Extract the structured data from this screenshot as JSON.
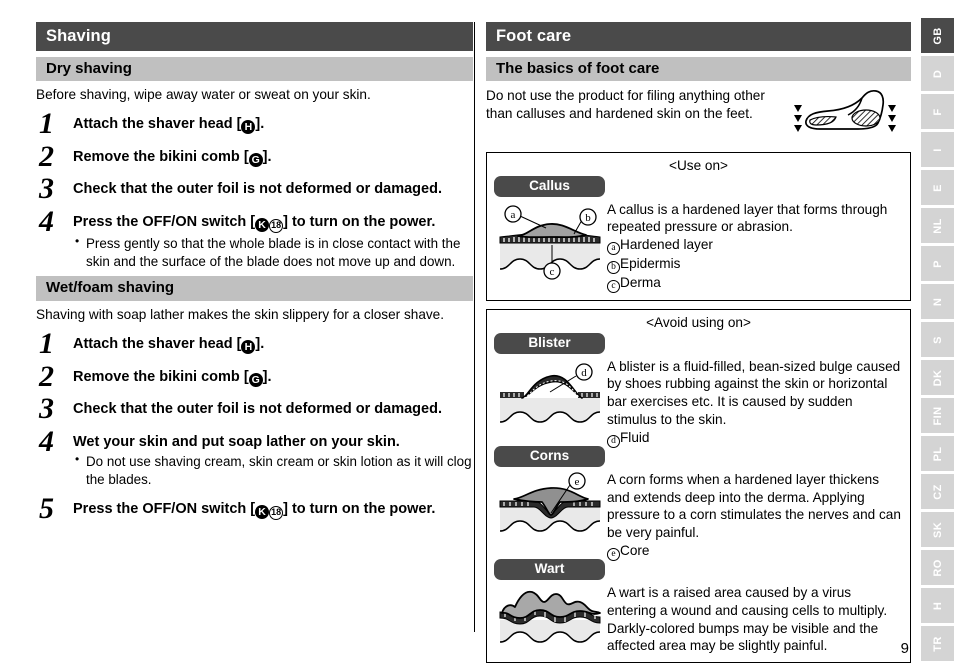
{
  "page_number": "9",
  "left_column": {
    "section_title": "Shaving",
    "subsections": [
      {
        "title": "Dry shaving",
        "intro": "Before shaving, wipe away water or sweat on your skin.",
        "steps": [
          {
            "num": "1",
            "text_before": "Attach the shaver head [",
            "ref": "H",
            "ref_type": "filled",
            "text_after": "].",
            "bullets": []
          },
          {
            "num": "2",
            "text_before": "Remove the bikini comb [",
            "ref": "G",
            "ref_type": "filled",
            "text_after": "].",
            "bullets": []
          },
          {
            "num": "3",
            "text_before": "Check that the outer foil is not deformed or damaged.",
            "ref": "",
            "ref_type": "none",
            "text_after": "",
            "bullets": []
          },
          {
            "num": "4",
            "text_before": "Press the OFF/ON switch [",
            "ref": "K",
            "ref_type": "filled",
            "ref2": "18",
            "ref2_type": "open",
            "text_after": "] to turn on the power.",
            "bullets": [
              "Press gently so that the whole blade is in close contact with the skin and the surface of the blade does not move up and down."
            ]
          }
        ]
      },
      {
        "title": "Wet/foam shaving",
        "intro": "Shaving with soap lather makes the skin slippery for a closer shave.",
        "steps": [
          {
            "num": "1",
            "text_before": "Attach the shaver head [",
            "ref": "H",
            "ref_type": "filled",
            "text_after": "].",
            "bullets": []
          },
          {
            "num": "2",
            "text_before": "Remove the bikini comb [",
            "ref": "G",
            "ref_type": "filled",
            "text_after": "].",
            "bullets": []
          },
          {
            "num": "3",
            "text_before": "Check that the outer foil is not deformed or damaged.",
            "ref": "",
            "ref_type": "none",
            "text_after": "",
            "bullets": []
          },
          {
            "num": "4",
            "text_before": "Wet your skin and put soap lather on your skin.",
            "ref": "",
            "ref_type": "none",
            "text_after": "",
            "bullets": [
              "Do not use shaving cream, skin cream or skin lotion as it will clog the blades."
            ]
          },
          {
            "num": "5",
            "text_before": "Press the OFF/ON switch [",
            "ref": "K",
            "ref_type": "filled",
            "ref2": "18",
            "ref2_type": "open",
            "text_after": "] to turn on the power.",
            "bullets": []
          }
        ]
      }
    ]
  },
  "right_column": {
    "section_title": "Foot care",
    "sub_title": "The basics of foot care",
    "basics_text": "Do not use the product for filing anything other than calluses and hardened skin on the feet.",
    "foot_figure_name": "foot-side-profile-with-callus-areas",
    "panels": [
      {
        "caption": "<Use on>",
        "conditions": [
          {
            "badge": "Callus",
            "description": "A callus is a hardened layer that forms through repeated pressure or abrasion.",
            "legend": [
              {
                "letter": "a",
                "label": "Hardened layer"
              },
              {
                "letter": "b",
                "label": "Epidermis"
              },
              {
                "letter": "c",
                "label": "Derma"
              }
            ],
            "figure_labels": [
              "a",
              "b",
              "c"
            ],
            "figure_name": "callus-skin-cross-section"
          }
        ]
      },
      {
        "caption": "<Avoid using on>",
        "conditions": [
          {
            "badge": "Blister",
            "description": "A blister is a fluid-filled, bean-sized bulge caused by shoes rubbing against the skin or horizontal bar exercises etc. It is caused by sudden stimulus to the skin.",
            "legend": [
              {
                "letter": "d",
                "label": "Fluid"
              }
            ],
            "figure_labels": [
              "d"
            ],
            "figure_name": "blister-skin-cross-section"
          },
          {
            "badge": "Corns",
            "description": "A corn forms when a hardened layer thickens and extends deep into the derma. Applying pressure to a corn stimulates the nerves and can be very painful.",
            "legend": [
              {
                "letter": "e",
                "label": "Core"
              }
            ],
            "figure_labels": [
              "e"
            ],
            "figure_name": "corn-skin-cross-section"
          },
          {
            "badge": "Wart",
            "description": "A wart is a raised area caused by a virus entering a wound and causing cells to multiply. Darkly-colored bumps may be visible and the affected area may be slightly painful.",
            "legend": [],
            "figure_labels": [],
            "figure_name": "wart-skin-cross-section"
          }
        ]
      }
    ]
  },
  "language_tabs": [
    {
      "label": "GB",
      "active": true
    },
    {
      "label": "D",
      "active": false
    },
    {
      "label": "F",
      "active": false
    },
    {
      "label": "I",
      "active": false
    },
    {
      "label": "E",
      "active": false
    },
    {
      "label": "NL",
      "active": false
    },
    {
      "label": "P",
      "active": false
    },
    {
      "label": "N",
      "active": false
    },
    {
      "label": "S",
      "active": false
    },
    {
      "label": "DK",
      "active": false
    },
    {
      "label": "FIN",
      "active": false
    },
    {
      "label": "PL",
      "active": false
    },
    {
      "label": "CZ",
      "active": false
    },
    {
      "label": "SK",
      "active": false
    },
    {
      "label": "RO",
      "active": false
    },
    {
      "label": "H",
      "active": false
    },
    {
      "label": "TR",
      "active": false
    }
  ],
  "colors": {
    "section_header_bg": "#4a4a4a",
    "sub_header_bg": "#c0c0c0",
    "badge_bg": "#4a4a4a",
    "tab_inactive": "#d4d4d4",
    "tab_active": "#4a4a4a",
    "derma_fill": "#e6e6e6",
    "hardened_fill": "#a8a8a8"
  }
}
